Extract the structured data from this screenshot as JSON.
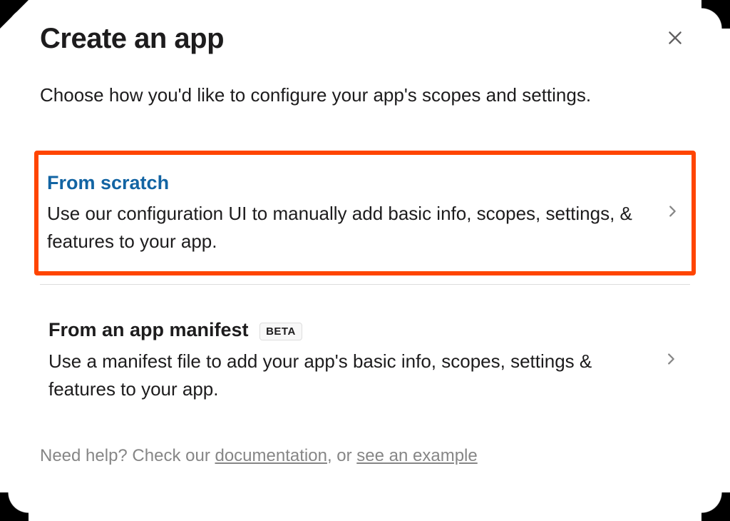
{
  "modal": {
    "title": "Create an app",
    "subtitle": "Choose how you'd like to configure your app's scopes and settings."
  },
  "options": {
    "scratch": {
      "title": "From scratch",
      "description": "Use our configuration UI to manually add basic info, scopes, settings, & features to your app."
    },
    "manifest": {
      "title": "From an app manifest",
      "badge": "BETA",
      "description": "Use a manifest file to add your app's basic info, scopes, settings & features to your app."
    }
  },
  "help": {
    "prefix": "Need help? Check our ",
    "doc_link": "documentation",
    "middle": ", or ",
    "example_link": "see an example"
  }
}
